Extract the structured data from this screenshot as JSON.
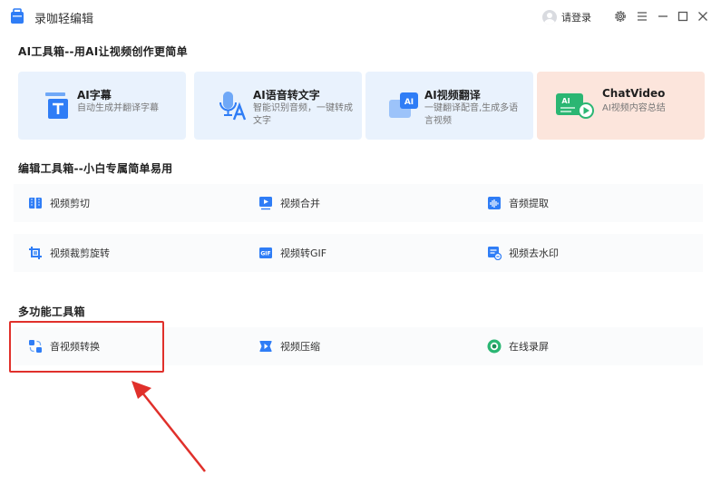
{
  "app": {
    "title": "录咖轻编辑",
    "login_label": "请登录"
  },
  "ai_section": {
    "title": "AI工具箱--用AI让视频创作更简单",
    "cards": [
      {
        "title": "AI字幕",
        "desc": "自动生成并翻译字幕",
        "icon": "subtitle-icon"
      },
      {
        "title": "AI语音转文字",
        "desc": "智能识别音频，一键转成文字",
        "icon": "speech-to-text-icon"
      },
      {
        "title": "AI视频翻译",
        "desc": "一键翻译配音,生成多语言视频",
        "icon": "video-translate-icon"
      },
      {
        "title": "ChatVideo",
        "desc": "AI视频内容总结",
        "icon": "chatvideo-icon"
      }
    ]
  },
  "edit_section": {
    "title": "编辑工具箱--小白专属简单易用",
    "tools": [
      {
        "label": "视频剪切",
        "icon": "video-cut-icon"
      },
      {
        "label": "视频合并",
        "icon": "video-merge-icon"
      },
      {
        "label": "音频提取",
        "icon": "audio-extract-icon"
      },
      {
        "label": "视频裁剪旋转",
        "icon": "crop-rotate-icon"
      },
      {
        "label": "视频转GIF",
        "icon": "gif-icon"
      },
      {
        "label": "视频去水印",
        "icon": "watermark-remove-icon"
      }
    ]
  },
  "multi_section": {
    "title": "多功能工具箱",
    "tools": [
      {
        "label": "音视频转换",
        "icon": "convert-icon"
      },
      {
        "label": "视频压缩",
        "icon": "compress-icon"
      },
      {
        "label": "在线录屏",
        "icon": "screen-record-icon"
      }
    ]
  },
  "colors": {
    "accent": "#2f7df6",
    "highlight": "#e0302b",
    "ai_card_bg": "#e9f2fd",
    "chatvideo_bg": "#fce5dc",
    "chatvideo_green": "#2bb673"
  }
}
